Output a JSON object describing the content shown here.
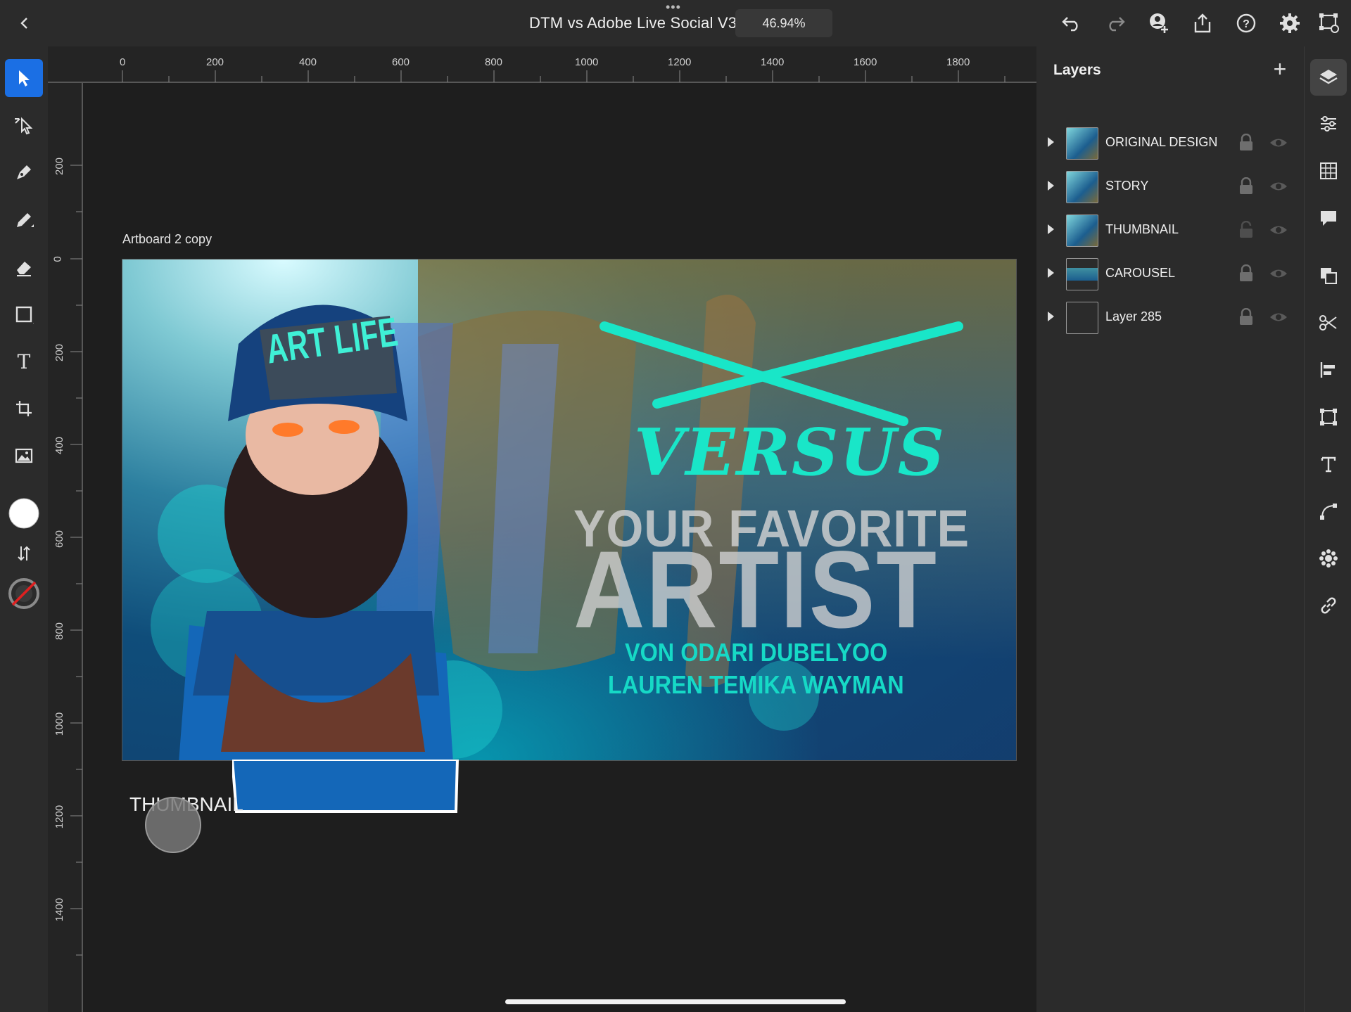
{
  "document": {
    "title": "DTM vs Adobe Live Social V3",
    "zoom": "46.94%"
  },
  "rulers": {
    "horizontal": [
      "0",
      "200",
      "400",
      "600",
      "800",
      "1000",
      "1200",
      "1400",
      "1600",
      "1800"
    ],
    "vertical": [
      "200",
      "0",
      "200",
      "400",
      "600",
      "800",
      "1000",
      "1200",
      "1400"
    ]
  },
  "artboard": {
    "label": "Artboard 2 copy",
    "cap_text": "ART LIFE",
    "versus": "VERSUS",
    "headline_1": "YOUR FAVORITE",
    "headline_2": "ARTIST",
    "name_1": "VON ODARI DUBELYOO",
    "name_2": "LAUREN TEMIKA WAYMAN"
  },
  "canvas": {
    "floating_label": "THUMBNAIL"
  },
  "layers": {
    "title": "Layers",
    "items": [
      {
        "name": "ORIGINAL DESIGN",
        "locked": true
      },
      {
        "name": "STORY",
        "locked": true
      },
      {
        "name": "THUMBNAIL",
        "locked": false
      },
      {
        "name": "CAROUSEL",
        "locked": true
      },
      {
        "name": "Layer 285",
        "locked": true
      }
    ]
  },
  "colors": {
    "accent": "#1b6fe4",
    "teal_text": "#16d9c6",
    "panel": "#2b2b2b",
    "canvas": "#1e1e1e"
  },
  "icons": {
    "top": [
      "back-icon",
      "undo-icon",
      "redo-icon",
      "invite-icon",
      "share-icon",
      "help-icon",
      "settings-icon",
      "frame-icon"
    ],
    "tools": [
      "select-icon",
      "direct-select-icon",
      "pen-icon",
      "pencil-icon",
      "eraser-icon",
      "rectangle-icon",
      "text-icon",
      "transform-icon",
      "image-icon",
      "fill-swatch",
      "swap-icon",
      "stroke-swatch"
    ],
    "right": [
      "layers-icon",
      "properties-icon",
      "grid-icon",
      "comments-icon",
      "arrange-icon",
      "cut-icon",
      "align-icon",
      "transform-panel-icon",
      "type-icon",
      "path-icon",
      "repeat-icon",
      "link-icon"
    ]
  }
}
